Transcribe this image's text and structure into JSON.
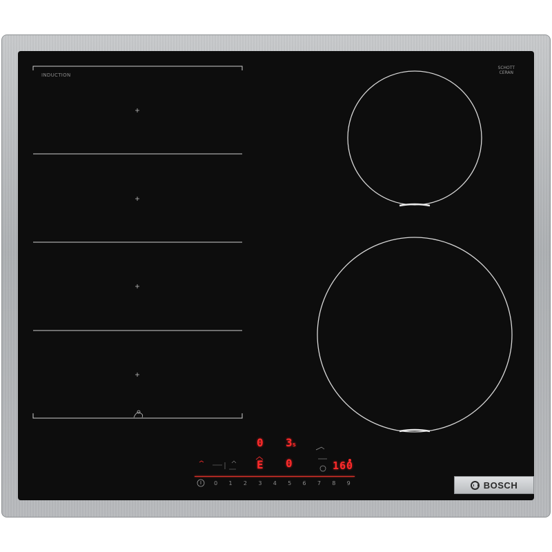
{
  "brand": {
    "logo_text": "BOSCH",
    "zone_label": "INDUCTION",
    "glass_maker_line1": "SCHOTT",
    "glass_maker_line2": "CERAN"
  },
  "display": {
    "zone_level_a": "0",
    "timer_value": "3",
    "timer_unit": "s",
    "zone_level_b": "0",
    "zone_code": "E",
    "temperature": "160"
  },
  "power_scale": [
    "0",
    "1",
    "2",
    "3",
    "4",
    "5",
    "6",
    "7",
    "8",
    "9"
  ],
  "colors": {
    "glass": "#0d0d0d",
    "frame": "#b9bbbe",
    "led": "#ff2a2a",
    "ring": "#d9d9d9"
  },
  "icons": [
    "power-icon",
    "plus-icon",
    "pan-icon",
    "timer-icon",
    "child-lock-icon",
    "cooking-sensor-icon"
  ]
}
